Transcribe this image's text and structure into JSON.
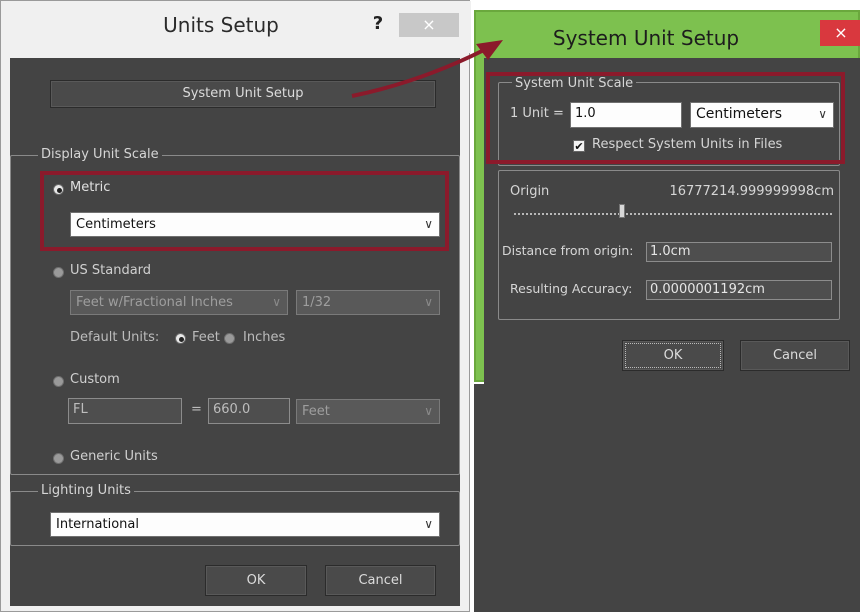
{
  "units_setup": {
    "title": "Units Setup",
    "help": "?",
    "close": "×",
    "system_unit_setup_button": "System Unit Setup",
    "display_unit_scale": {
      "legend": "Display Unit Scale",
      "metric": {
        "label": "Metric",
        "selected": true,
        "value": "Centimeters"
      },
      "us_standard": {
        "label": "US Standard",
        "selected": false,
        "value": "Feet w/Fractional Inches",
        "fraction": "1/32",
        "default_units_label": "Default Units:",
        "feet": "Feet",
        "inches": "Inches"
      },
      "custom": {
        "label": "Custom",
        "selected": false,
        "name": "FL",
        "equals": "=",
        "amount": "660.0",
        "unit": "Feet"
      },
      "generic": {
        "label": "Generic Units",
        "selected": false
      }
    },
    "lighting_units": {
      "legend": "Lighting Units",
      "value": "International"
    },
    "ok": "OK",
    "cancel": "Cancel"
  },
  "system_unit_setup": {
    "title": "System Unit Setup",
    "close": "×",
    "scale": {
      "legend": "System Unit Scale",
      "unit_label": "1 Unit =",
      "unit_value": "1.0",
      "unit_type": "Centimeters",
      "respect_label": "Respect System Units in Files",
      "respect_checked": true
    },
    "origin": {
      "label": "Origin",
      "value": "16777214.999999998cm",
      "slider_fraction": 0.34
    },
    "distance_label": "Distance from origin:",
    "distance_value": "1.0cm",
    "accuracy_label": "Resulting Accuracy:",
    "accuracy_value": "0.0000001192cm",
    "ok": "OK",
    "cancel": "Cancel"
  },
  "colors": {
    "highlight_box": "#8b1a2b",
    "active_titlebar": "#7dc14f",
    "close_button": "#d9383e",
    "panel": "#444444"
  },
  "icons": {
    "dropdown": "chevron-down-icon",
    "help": "help-icon",
    "close": "close-icon",
    "checkbox": "checkmark-icon"
  }
}
